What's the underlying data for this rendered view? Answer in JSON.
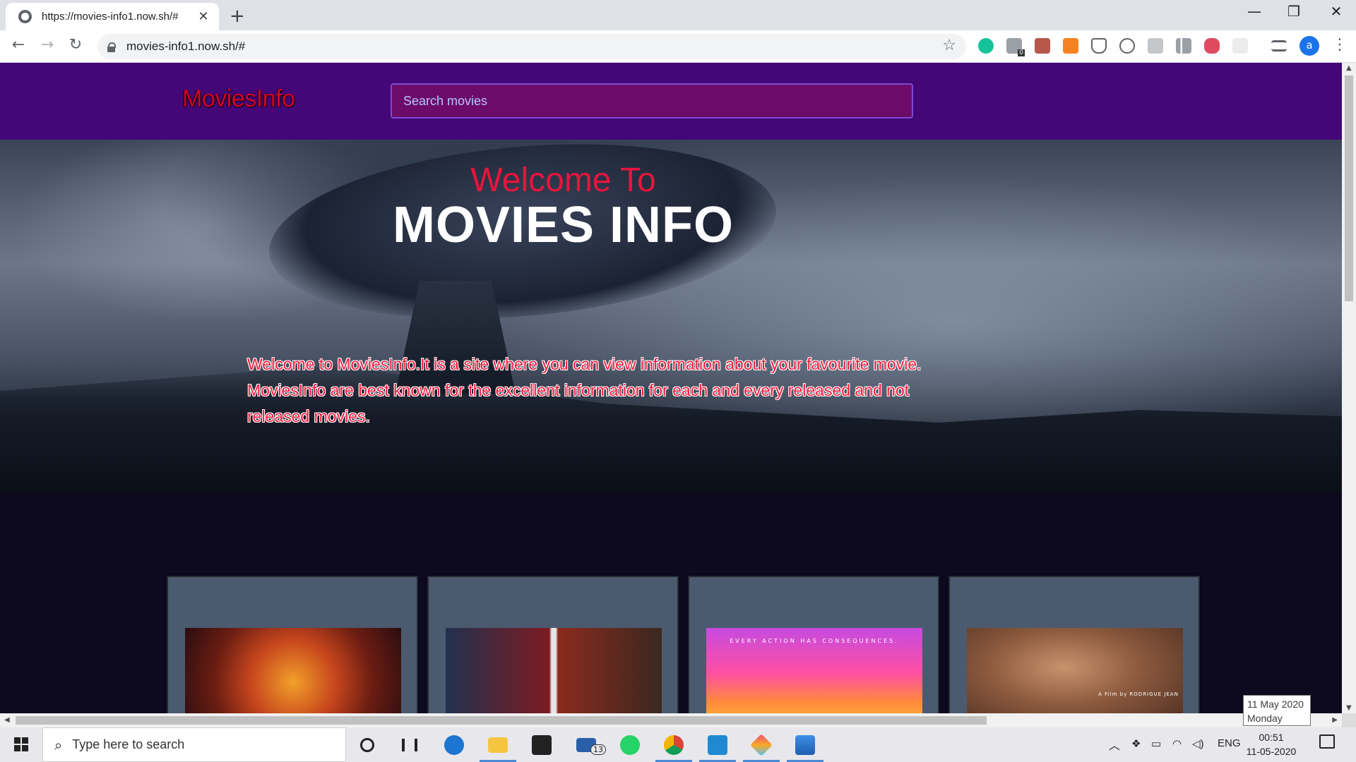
{
  "browser": {
    "tab_title": "https://movies-info1.now.sh/#",
    "url": "movies-info1.now.sh/#",
    "new_tab": "+",
    "profile_initial": "a",
    "extension_badge": "0",
    "icons": [
      "back-arrow-icon",
      "forward-arrow-icon",
      "reload-icon",
      "lock-icon",
      "star-icon",
      "grammarly-icon",
      "menu-kebab-icon"
    ]
  },
  "site": {
    "logo": "MoviesInfo",
    "search_placeholder": "Search movies",
    "hero": {
      "welcome_to": "Welcome To",
      "title": "MOVIES INFO",
      "description": "Welcome to MoviesInfo.It is a site where you can view information about your favourite movie. MoviesInfo are best known for the excellent information for each and every released and not released movies."
    },
    "cards": [
      {
        "poster": "Avengers: Infinity War"
      },
      {
        "poster": "Captain America: Civil War"
      },
      {
        "poster": "John Wick 3",
        "caption": "EVERY ACTION HAS CONSEQUENCES."
      },
      {
        "poster": "Portrait film",
        "caption": "A Film by RODRIGUE JEAN"
      }
    ],
    "colors": {
      "header": "#430777",
      "search_bg": "#6d0b6a",
      "logo": "#d4002a",
      "accent_red": "#e8143c",
      "body_bg": "#0d0a1f",
      "card_bg": "#4b5a6e"
    }
  },
  "tooltip": {
    "date": "11 May 2020",
    "day": "Monday"
  },
  "taskbar": {
    "search_placeholder": "Type here to search",
    "mail_badge": "13",
    "language": "ENG",
    "time": "00:51",
    "date": "11-05-2020"
  }
}
